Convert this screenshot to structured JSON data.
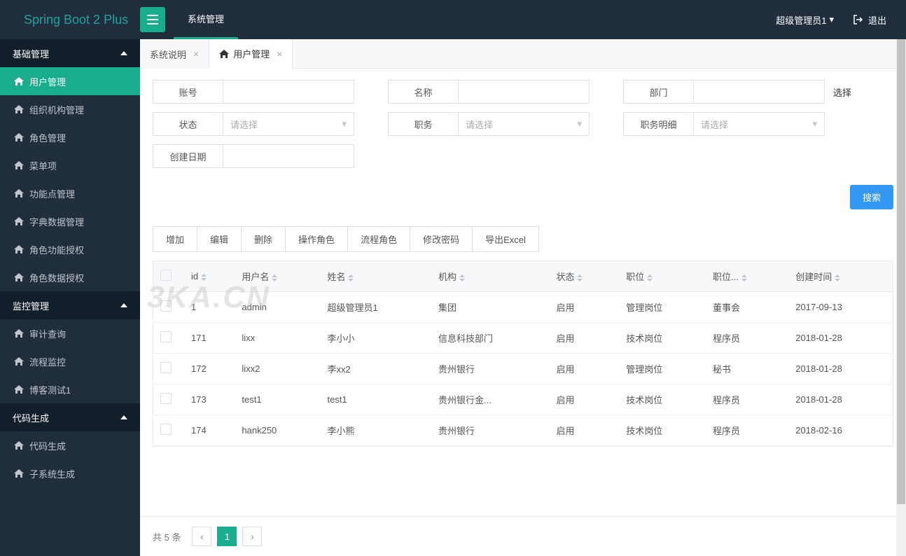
{
  "app": {
    "name": "Spring Boot 2 Plus"
  },
  "header": {
    "topTab": "系统管理",
    "user": "超级管理员1",
    "logout": "退出"
  },
  "sidebar": {
    "groups": [
      {
        "title": "基础管理",
        "items": [
          "用户管理",
          "组织机构管理",
          "角色管理",
          "菜单项",
          "功能点管理",
          "字典数据管理",
          "角色功能授权",
          "角色数据授权"
        ],
        "activeIndex": 0
      },
      {
        "title": "监控管理",
        "items": [
          "审计查询",
          "流程监控",
          "博客测试1"
        ]
      },
      {
        "title": "代码生成",
        "items": [
          "代码生成",
          "子系统生成"
        ]
      }
    ]
  },
  "pageTabs": {
    "items": [
      {
        "label": "系统说明",
        "closable": true,
        "icon": false
      },
      {
        "label": "用户管理",
        "closable": true,
        "icon": true
      }
    ],
    "activeIndex": 1
  },
  "search": {
    "fields": {
      "account": "账号",
      "name": "名称",
      "dept": "部门",
      "select": "选择",
      "status": "状态",
      "job": "职务",
      "jobDetail": "职务明细",
      "createDate": "创建日期"
    },
    "placeholder": "请选择",
    "button": "搜索"
  },
  "toolbar": {
    "add": "增加",
    "edit": "编辑",
    "delete": "删除",
    "opRole": "操作角色",
    "flowRole": "流程角色",
    "changePwd": "修改密码",
    "export": "导出Excel"
  },
  "table": {
    "columns": [
      "id",
      "用户名",
      "姓名",
      "机构",
      "状态",
      "职位",
      "职位...",
      "创建时间"
    ],
    "rows": [
      {
        "id": "1",
        "username": "admin",
        "name": "超级管理员1",
        "org": "集团",
        "status": "启用",
        "position": "管理岗位",
        "posDetail": "董事会",
        "created": "2017-09-13"
      },
      {
        "id": "171",
        "username": "lixx",
        "name": "李小小",
        "org": "信息科技部门",
        "status": "启用",
        "position": "技术岗位",
        "posDetail": "程序员",
        "created": "2018-01-28"
      },
      {
        "id": "172",
        "username": "lixx2",
        "name": "李xx2",
        "org": "贵州银行",
        "status": "启用",
        "position": "管理岗位",
        "posDetail": "秘书",
        "created": "2018-01-28"
      },
      {
        "id": "173",
        "username": "test1",
        "name": "test1",
        "org": "贵州银行金...",
        "status": "启用",
        "position": "技术岗位",
        "posDetail": "程序员",
        "created": "2018-01-28"
      },
      {
        "id": "174",
        "username": "hank250",
        "name": "李小熊",
        "org": "贵州银行",
        "status": "启用",
        "position": "技术岗位",
        "posDetail": "程序员",
        "created": "2018-02-16"
      }
    ]
  },
  "pagination": {
    "total": "共 5 条",
    "current": "1"
  },
  "watermark": "3KA.CN"
}
